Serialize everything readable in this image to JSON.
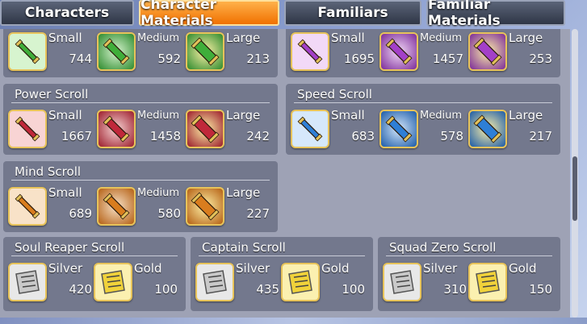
{
  "tabs": [
    {
      "label": "Characters",
      "active": false
    },
    {
      "label": "Character Materials",
      "active": true
    },
    {
      "label": "Familiars",
      "active": false
    },
    {
      "label": "Familiar Materials",
      "active": false
    }
  ],
  "colors": {
    "green": "#3fae3a",
    "purple": "#a340c8",
    "red": "#c0283a",
    "blue": "#2e7fd6",
    "orange": "#d97d1e",
    "tab_active": "#f07000",
    "silver": "#c9c9c9",
    "gold": "#f0d23a"
  },
  "panels": {
    "green_scroll": {
      "items": [
        {
          "tier": "Small",
          "count": "744",
          "icon": "green-scroll-small-icon"
        },
        {
          "tier": "Medium",
          "count": "592",
          "icon": "green-scroll-medium-icon"
        },
        {
          "tier": "Large",
          "count": "213",
          "icon": "green-scroll-large-icon"
        }
      ]
    },
    "purple_scroll": {
      "items": [
        {
          "tier": "Small",
          "count": "1695",
          "icon": "purple-scroll-small-icon"
        },
        {
          "tier": "Medium",
          "count": "1457",
          "icon": "purple-scroll-medium-icon"
        },
        {
          "tier": "Large",
          "count": "253",
          "icon": "purple-scroll-large-icon"
        }
      ]
    },
    "power_scroll": {
      "title": "Power Scroll",
      "items": [
        {
          "tier": "Small",
          "count": "1667",
          "icon": "power-scroll-small-icon"
        },
        {
          "tier": "Medium",
          "count": "1458",
          "icon": "power-scroll-medium-icon"
        },
        {
          "tier": "Large",
          "count": "242",
          "icon": "power-scroll-large-icon"
        }
      ]
    },
    "speed_scroll": {
      "title": "Speed Scroll",
      "items": [
        {
          "tier": "Small",
          "count": "683",
          "icon": "speed-scroll-small-icon"
        },
        {
          "tier": "Medium",
          "count": "578",
          "icon": "speed-scroll-medium-icon"
        },
        {
          "tier": "Large",
          "count": "217",
          "icon": "speed-scroll-large-icon"
        }
      ]
    },
    "mind_scroll": {
      "title": "Mind Scroll",
      "items": [
        {
          "tier": "Small",
          "count": "689",
          "icon": "mind-scroll-small-icon"
        },
        {
          "tier": "Medium",
          "count": "580",
          "icon": "mind-scroll-medium-icon"
        },
        {
          "tier": "Large",
          "count": "227",
          "icon": "mind-scroll-large-icon"
        }
      ]
    },
    "soul_reaper_scroll": {
      "title": "Soul Reaper Scroll",
      "items": [
        {
          "tier": "Silver",
          "count": "420",
          "icon": "soul-reaper-silver-scroll-icon"
        },
        {
          "tier": "Gold",
          "count": "100",
          "icon": "soul-reaper-gold-scroll-icon"
        }
      ]
    },
    "captain_scroll": {
      "title": "Captain Scroll",
      "items": [
        {
          "tier": "Silver",
          "count": "435",
          "icon": "captain-silver-scroll-icon"
        },
        {
          "tier": "Gold",
          "count": "100",
          "icon": "captain-gold-scroll-icon"
        }
      ]
    },
    "squad_zero_scroll": {
      "title": "Squad Zero Scroll",
      "items": [
        {
          "tier": "Silver",
          "count": "310",
          "icon": "squad-zero-silver-scroll-icon"
        },
        {
          "tier": "Gold",
          "count": "150",
          "icon": "squad-zero-gold-scroll-icon"
        }
      ]
    }
  }
}
